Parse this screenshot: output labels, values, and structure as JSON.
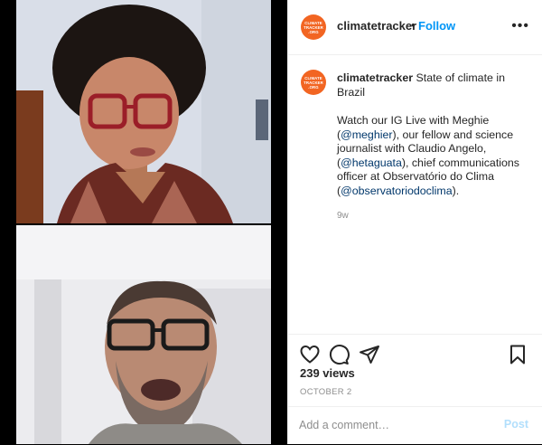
{
  "author": {
    "username": "climatetracker",
    "avatar_text": "CLIMATE TRACKER .ORG"
  },
  "header": {
    "dot": "•",
    "follow_label": "Follow",
    "more_label": "•••"
  },
  "caption": {
    "username": "climatetracker",
    "title": "State of climate in Brazil",
    "text_1": "Watch our IG Live with Meghie (",
    "mention_1": "@meghier",
    "text_2": "), our fellow and science journalist with Claudio Angelo, (",
    "mention_2": "@hetaguata",
    "text_3": "), chief communications officer at Observatório do Clima (",
    "mention_3": "@observatoriodoclima",
    "text_4": ").",
    "time": "9w"
  },
  "stats": {
    "views": "239 views",
    "date": "OCTOBER 2"
  },
  "comment": {
    "placeholder": "Add a comment…",
    "post_label": "Post"
  },
  "icons": [
    "heart-icon",
    "comment-icon",
    "share-icon",
    "bookmark-icon",
    "more-icon"
  ],
  "colors": {
    "brand_orange": "#f26522",
    "link_blue": "#0095f6",
    "post_disabled": "#b2dffc",
    "muted": "#8e8e8e"
  }
}
